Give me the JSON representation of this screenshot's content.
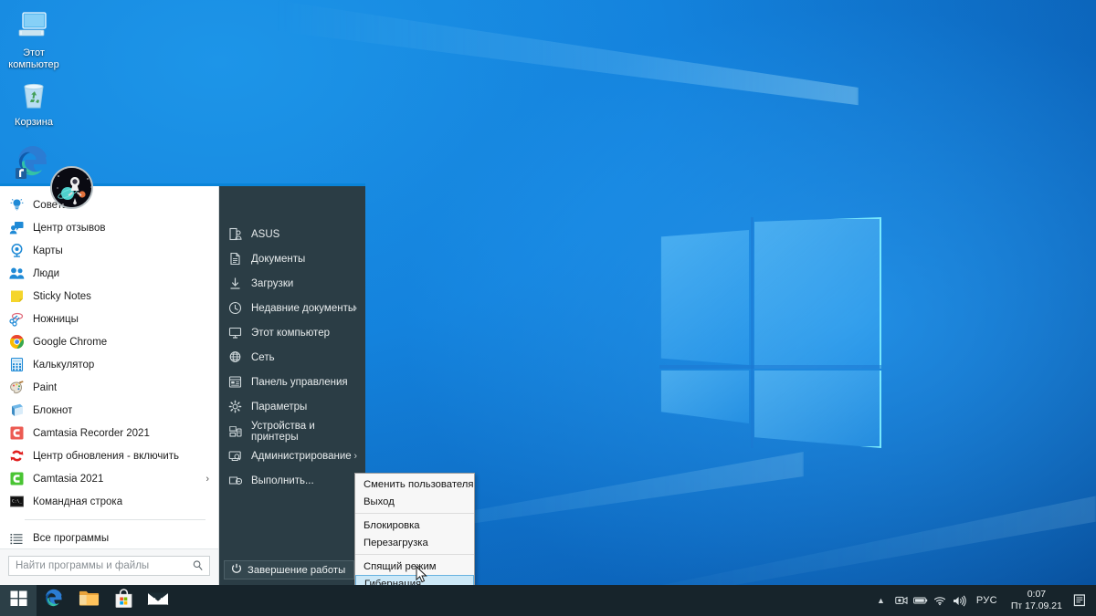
{
  "desktop": {
    "icons": [
      {
        "label": "Этот компьютер",
        "icon": "this-pc-icon"
      },
      {
        "label": "Корзина",
        "icon": "recycle-bin-icon"
      },
      {
        "label": "",
        "icon": "microsoft-edge-icon"
      }
    ]
  },
  "start_menu": {
    "accent_color": "#0a84d8",
    "left_panel_bg": "#ffffff",
    "right_panel_bg": "#2b3d45",
    "programs": [
      {
        "label": "Советы",
        "icon": "tips-lightbulb-icon",
        "has_submenu": false
      },
      {
        "label": "Центр отзывов",
        "icon": "feedback-hub-icon",
        "has_submenu": false
      },
      {
        "label": "Карты",
        "icon": "maps-icon",
        "has_submenu": false
      },
      {
        "label": "Люди",
        "icon": "people-icon",
        "has_submenu": false
      },
      {
        "label": "Sticky Notes",
        "icon": "sticky-notes-icon",
        "has_submenu": false
      },
      {
        "label": "Ножницы",
        "icon": "snipping-tool-icon",
        "has_submenu": false
      },
      {
        "label": "Google Chrome",
        "icon": "google-chrome-icon",
        "has_submenu": false
      },
      {
        "label": "Калькулятор",
        "icon": "calculator-icon",
        "has_submenu": false
      },
      {
        "label": "Paint",
        "icon": "paint-icon",
        "has_submenu": false
      },
      {
        "label": "Блокнот",
        "icon": "notepad-icon",
        "has_submenu": false
      },
      {
        "label": "Camtasia Recorder 2021",
        "icon": "camtasia-recorder-icon",
        "has_submenu": false
      },
      {
        "label": "Центр обновления - включить",
        "icon": "windows-update-icon",
        "has_submenu": false
      },
      {
        "label": "Camtasia 2021",
        "icon": "camtasia-icon",
        "has_submenu": true
      },
      {
        "label": "Командная строка",
        "icon": "command-prompt-icon",
        "has_submenu": false
      }
    ],
    "all_programs": {
      "label": "Все программы",
      "icon": "all-programs-icon"
    },
    "search": {
      "placeholder": "Найти программы и файлы",
      "value": "",
      "icon": "search-icon"
    },
    "user": {
      "avatar": "astronaut-space-avatar"
    },
    "places": [
      {
        "label": "ASUS",
        "icon": "user-folder-icon",
        "has_submenu": false
      },
      {
        "label": "Документы",
        "icon": "documents-icon",
        "has_submenu": false
      },
      {
        "label": "Загрузки",
        "icon": "downloads-icon",
        "has_submenu": false
      },
      {
        "label": "Недавние документы",
        "icon": "recent-documents-clock-icon",
        "has_submenu": true
      },
      {
        "label": "Этот компьютер",
        "icon": "this-pc-monitor-icon",
        "has_submenu": false
      },
      {
        "label": "Сеть",
        "icon": "network-globe-icon",
        "has_submenu": false
      },
      {
        "label": "Панель управления",
        "icon": "control-panel-icon",
        "has_submenu": false
      },
      {
        "label": "Параметры",
        "icon": "settings-gear-icon",
        "has_submenu": false
      },
      {
        "label": "Устройства и принтеры",
        "icon": "devices-printers-icon",
        "has_submenu": false
      },
      {
        "label": "Администрирование",
        "icon": "administrative-tools-icon",
        "has_submenu": true
      },
      {
        "label": "Выполнить...",
        "icon": "run-dialog-icon",
        "has_submenu": false
      }
    ],
    "power": {
      "label": "Завершение работы",
      "icon": "power-icon",
      "arrow": "›",
      "menu": [
        {
          "label": "Сменить пользователя",
          "selected": false
        },
        {
          "label": "Выход",
          "selected": false
        },
        {
          "separator": true
        },
        {
          "label": "Блокировка",
          "selected": false
        },
        {
          "label": "Перезагрузка",
          "selected": false
        },
        {
          "separator": true
        },
        {
          "label": "Спящий режим",
          "selected": false
        },
        {
          "label": "Гибернация",
          "selected": true
        }
      ],
      "highlight_bg": "#cce8f7",
      "highlight_border": "#68b2e0"
    }
  },
  "taskbar": {
    "bg": "#17242b",
    "start_button": {
      "icon": "windows-start-icon"
    },
    "pinned": [
      {
        "name": "Microsoft Edge",
        "icon": "microsoft-edge-icon"
      },
      {
        "name": "Проводник",
        "icon": "file-explorer-icon"
      },
      {
        "name": "Microsoft Store",
        "icon": "microsoft-store-icon"
      },
      {
        "name": "Почта",
        "icon": "mail-icon"
      }
    ],
    "tray": {
      "overflow": {
        "icon": "show-hidden-icons-chevron-up"
      },
      "icons": [
        {
          "name": "screen-recorder-icon"
        },
        {
          "name": "battery-icon"
        },
        {
          "name": "wifi-icon"
        },
        {
          "name": "volume-icon"
        }
      ],
      "language": "РУС",
      "time": "0:07",
      "date": "Пт 17.09.21",
      "action_center": {
        "icon": "action-center-icon"
      }
    }
  }
}
